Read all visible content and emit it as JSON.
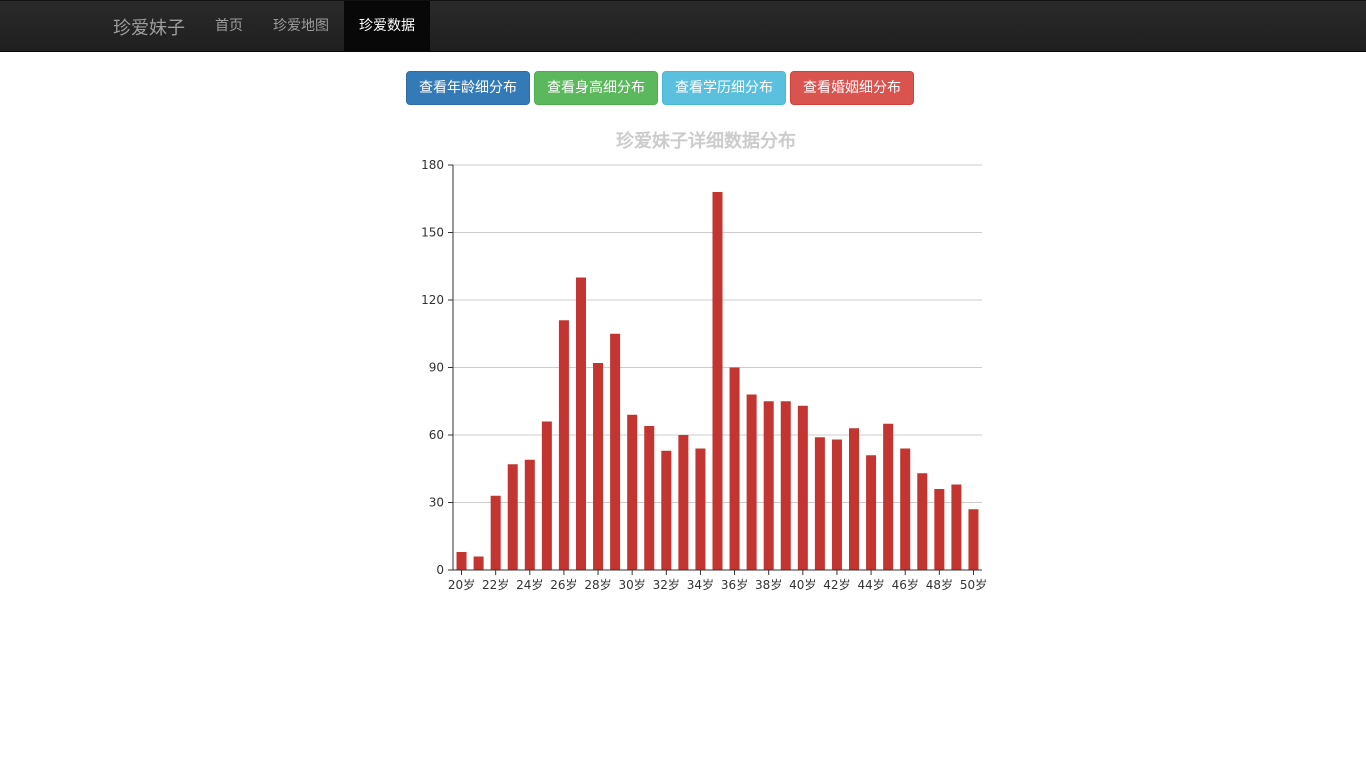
{
  "navbar": {
    "brand": "珍爱妹子",
    "items": [
      {
        "label": "首页",
        "active": false
      },
      {
        "label": "珍爱地图",
        "active": false
      },
      {
        "label": "珍爱数据",
        "active": true
      }
    ]
  },
  "buttons": {
    "age": "查看年龄细分布",
    "height": "查看身高细分布",
    "education": "查看学历细分布",
    "marriage": "查看婚姻细分布"
  },
  "colors": {
    "bar": "#c23531",
    "primary": "#337ab7",
    "success": "#5cb85c",
    "info": "#5bc0de",
    "danger": "#d9534f"
  },
  "chart_data": {
    "type": "bar",
    "title": "珍爱妹子详细数据分布",
    "xlabel": "",
    "ylabel": "",
    "ylim": [
      0,
      180
    ],
    "yticks": [
      0,
      30,
      60,
      90,
      120,
      150,
      180
    ],
    "grid": true,
    "categories": [
      "20岁",
      "21岁",
      "22岁",
      "23岁",
      "24岁",
      "25岁",
      "26岁",
      "27岁",
      "28岁",
      "29岁",
      "30岁",
      "31岁",
      "32岁",
      "33岁",
      "34岁",
      "35岁",
      "36岁",
      "37岁",
      "38岁",
      "39岁",
      "40岁",
      "41岁",
      "42岁",
      "43岁",
      "44岁",
      "45岁",
      "46岁",
      "47岁",
      "48岁",
      "49岁",
      "50岁"
    ],
    "tick_labels": [
      "20岁",
      "22岁",
      "24岁",
      "26岁",
      "28岁",
      "30岁",
      "32岁",
      "34岁",
      "36岁",
      "38岁",
      "40岁",
      "42岁",
      "44岁",
      "46岁",
      "48岁",
      "50岁"
    ],
    "values": [
      8,
      6,
      33,
      47,
      49,
      66,
      111,
      130,
      92,
      105,
      69,
      64,
      53,
      60,
      54,
      168,
      90,
      78,
      75,
      75,
      73,
      59,
      58,
      63,
      51,
      65,
      54,
      43,
      36,
      38,
      27
    ]
  }
}
